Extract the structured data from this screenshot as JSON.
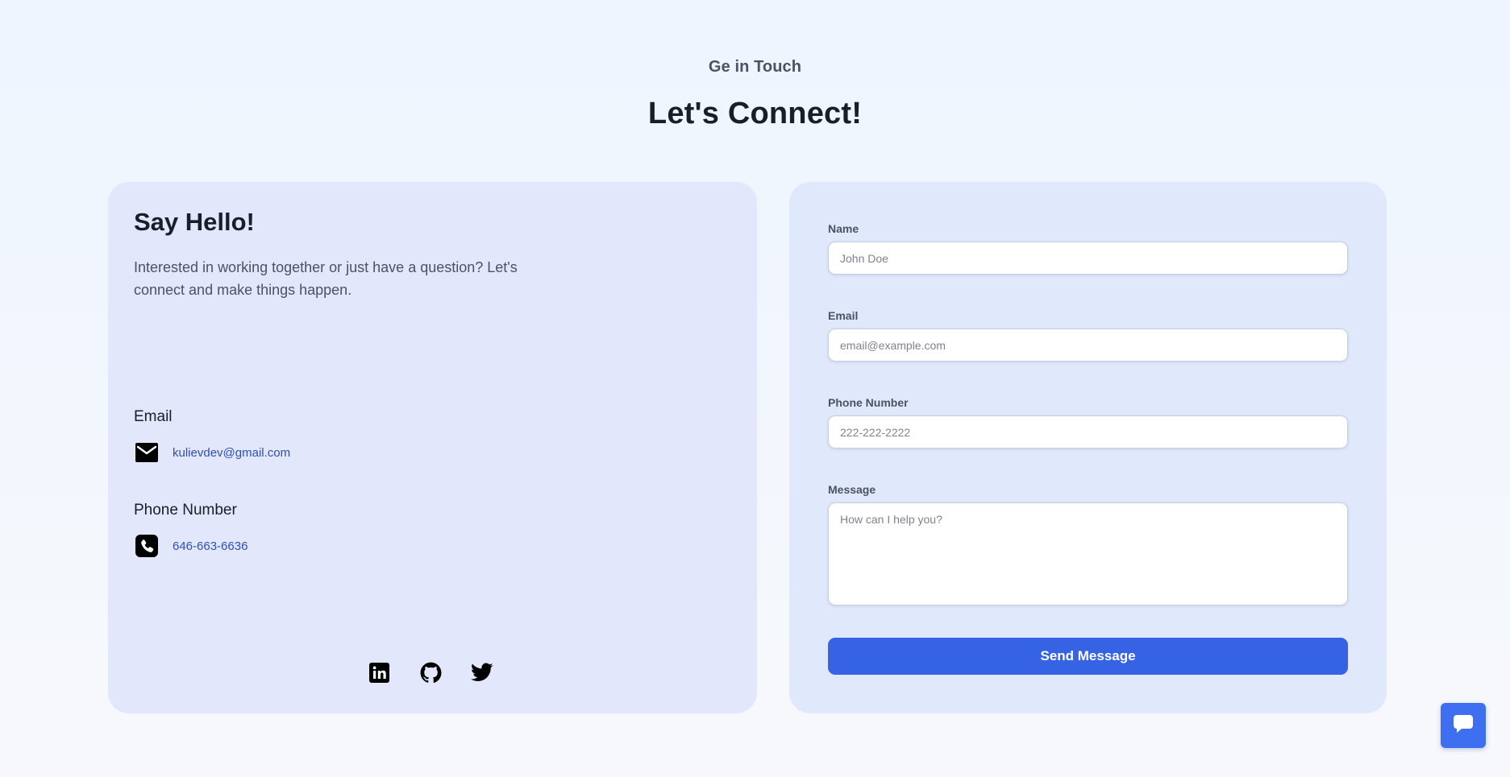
{
  "header": {
    "eyebrow": "Ge in Touch",
    "title": "Let's Connect!"
  },
  "intro_card": {
    "heading": "Say Hello!",
    "text": "Interested in working together or just have a question? Let's connect and make things happen.",
    "email": {
      "label": "Email",
      "value": "kulievdev@gmail.com",
      "icon": "mail-icon"
    },
    "phone": {
      "label": "Phone Number",
      "value": "646-663-6636",
      "icon": "phone-icon"
    },
    "social": [
      "linkedin-icon",
      "github-icon",
      "twitter-icon"
    ]
  },
  "form": {
    "name": {
      "label": "Name",
      "placeholder": "John Doe",
      "value": ""
    },
    "email": {
      "label": "Email",
      "placeholder": "email@example.com",
      "value": ""
    },
    "phone": {
      "label": "Phone Number",
      "placeholder": "222-222-2222",
      "value": ""
    },
    "message": {
      "label": "Message",
      "placeholder": "How can I help you?",
      "value": ""
    },
    "submit_label": "Send Message"
  },
  "chat": {
    "icon": "chat-bubble-icon"
  },
  "colors": {
    "accent": "#3563e3",
    "link": "#2f4fb7",
    "card_left": "#e2e7fc",
    "card_right": "#e0e8fb"
  }
}
